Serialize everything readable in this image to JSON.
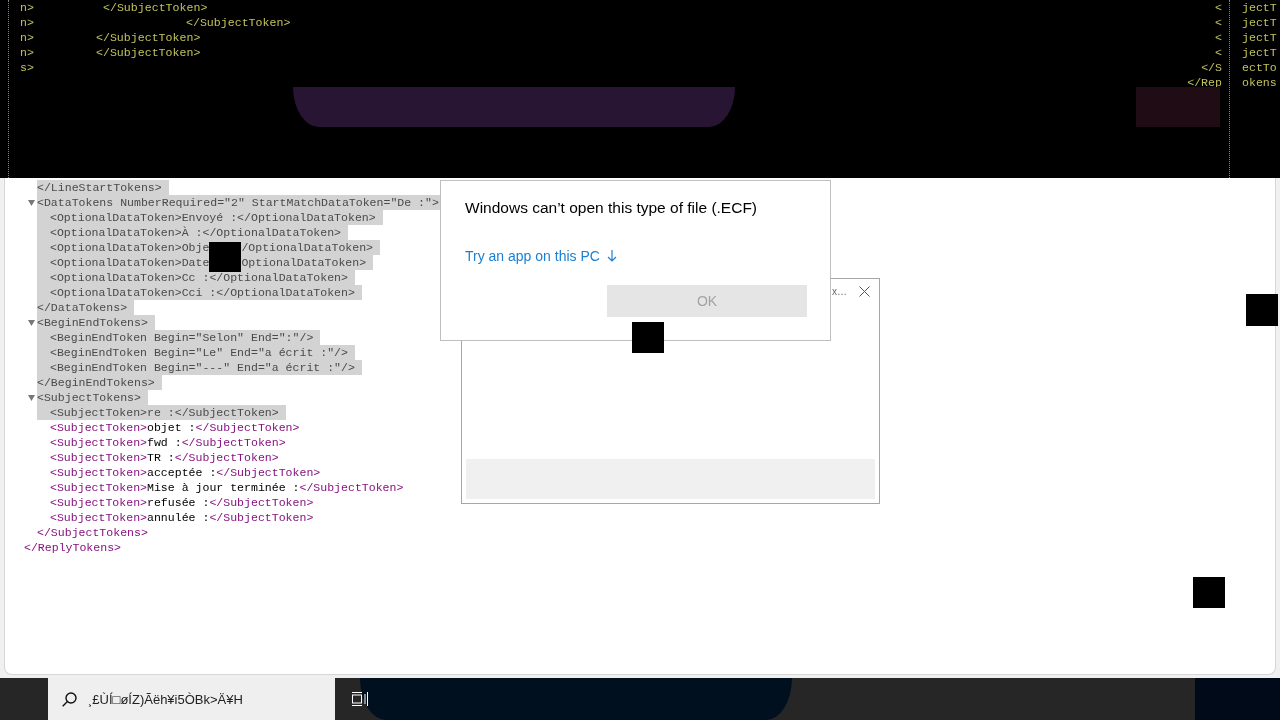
{
  "top_band": {
    "left_lines": [
      {
        "stub": "n>",
        "text": "</SubjectToken>"
      },
      {
        "stub": "n>",
        "text": "</SubjectToken>"
      },
      {
        "stub": "n>",
        "text": "</SubjectToken>"
      },
      {
        "stub": "n>",
        "text": "</SubjectToken>"
      },
      {
        "stub": "s>"
      }
    ],
    "right_lines": [
      {
        "before": "<",
        "after": "jectT"
      },
      {
        "before": "<",
        "after": "jectT"
      },
      {
        "before": "<",
        "after": "jectT"
      },
      {
        "before": "<",
        "after": "jectT"
      },
      {
        "before": "</S",
        "after": "ectTo"
      },
      {
        "before": "</Rep",
        "after": "okens"
      }
    ]
  },
  "xml_viewer": {
    "root": {
      "children": [
        {
          "text": "</LineStartTokens>",
          "selected": true
        },
        {
          "open": "<DataTokens NumberRequired=\"2\" StartMatchDataToken=\"De :\">",
          "open_selected": true,
          "expanded": true,
          "children": [
            {
              "text": "<OptionalDataToken>Envoyé :</OptionalDataToken>",
              "selected": true
            },
            {
              "text": "<OptionalDataToken>À :</OptionalDataToken>",
              "selected": true
            },
            {
              "text": "<OptionalDataToken>Obje",
              "text_after": "/OptionalDataToken>",
              "selected": true
            },
            {
              "text": "<OptionalDataToken>Date",
              "text_after": "OptionalDataToken>",
              "selected": true
            },
            {
              "text": "<OptionalDataToken>Cc :</OptionalDataToken>",
              "selected": true
            },
            {
              "text": "<OptionalDataToken>Cci :</OptionalDataToken>",
              "selected": true
            }
          ],
          "close": "</DataTokens>",
          "close_selected": true
        },
        {
          "open": "<BeginEndTokens>",
          "open_selected": true,
          "expanded": true,
          "children": [
            {
              "text": "<BeginEndToken Begin=\"Selon\" End=\":\"/>",
              "selected": true
            },
            {
              "text": "<BeginEndToken Begin=\"Le\" End=\"a écrit :\"/>",
              "selected": true
            },
            {
              "text": "<BeginEndToken Begin=\"---\" End=\"a écrit :\"/>",
              "selected": true
            }
          ],
          "close": "</BeginEndTokens>",
          "close_selected": true
        },
        {
          "open": "<SubjectTokens>",
          "open_selected": true,
          "expanded": true,
          "children": [
            {
              "text": "<SubjectToken>re :</SubjectToken>",
              "selected": true
            },
            {
              "text": "<SubjectToken>objet :</SubjectToken>",
              "selected": false
            },
            {
              "text": "<SubjectToken>fwd :</SubjectToken>",
              "selected": false
            },
            {
              "text": "<SubjectToken>TR :</SubjectToken>",
              "selected": false
            },
            {
              "text": "<SubjectToken>acceptée :</SubjectToken>",
              "selected": false
            },
            {
              "text": "<SubjectToken>Mise à jour terminée :</SubjectToken>",
              "selected": false
            },
            {
              "text": "<SubjectToken>refusée :</SubjectToken>",
              "selected": false
            },
            {
              "text": "<SubjectToken>annulée :</SubjectToken>",
              "selected": false
            }
          ],
          "close": "</SubjectTokens>",
          "close_selected": false
        }
      ],
      "close": "</ReplyTokens>",
      "close_selected": false
    }
  },
  "dialog": {
    "title": "Windows can’t open this type of file (.ECF)",
    "link": "Try an app on this PC",
    "ok_button": {
      "label": "OK",
      "disabled": true
    }
  },
  "background_window": {
    "title": "x…"
  },
  "taskbar": {
    "search": {
      "value": "¸£ÙÍ□øÍZ)Ãëh¥i5ÒBk>Ä¥H"
    }
  }
}
